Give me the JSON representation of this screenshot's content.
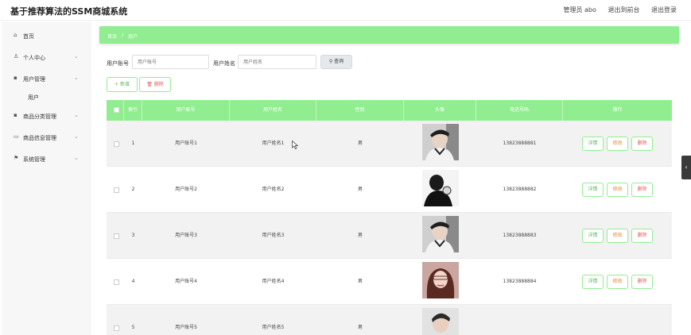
{
  "app": {
    "title": "基于推荐算法的SSM商城系统"
  },
  "topbar": {
    "admin_label": "管理员 abo",
    "back_label": "退出到前台",
    "logout_label": "退出登录"
  },
  "sidebar": {
    "items": [
      {
        "icon": "home-icon",
        "glyph": "⌂",
        "label": "首页",
        "chevron": ""
      },
      {
        "icon": "user-icon",
        "glyph": "♙",
        "label": "个人中心",
        "chevron": "⌄"
      },
      {
        "icon": "grid-icon",
        "glyph": "▪",
        "label": "用户管理",
        "chevron": "⌄"
      },
      {
        "icon": "",
        "glyph": "",
        "label": "用户",
        "chevron": ""
      },
      {
        "icon": "grid-icon",
        "glyph": "▪",
        "label": "商品分类管理",
        "chevron": "⌄"
      },
      {
        "icon": "shop-icon",
        "glyph": "▭",
        "label": "商品信息管理",
        "chevron": "⌄"
      },
      {
        "icon": "flag-icon",
        "glyph": "⚑",
        "label": "系统管理",
        "chevron": "⌄"
      }
    ]
  },
  "breadcrumb": {
    "home": "首页",
    "separator": "/",
    "current": "用户"
  },
  "search": {
    "account_label": "用户账号",
    "account_placeholder": "用户账号",
    "name_label": "用户姓名",
    "name_placeholder": "用户姓名",
    "button_label": "查询",
    "button_icon": "search-icon"
  },
  "actions": {
    "add_label": "新增",
    "delete_label": "删除"
  },
  "table": {
    "headers": {
      "index": "索引",
      "account": "用户账号",
      "name": "用户姓名",
      "gender": "性别",
      "avatar": "头像",
      "phone": "电话号码",
      "ops": "操作"
    },
    "rows": [
      {
        "index": "1",
        "account": "用户账号1",
        "name": "用户姓名1",
        "gender": "男",
        "phone": "13823888881"
      },
      {
        "index": "2",
        "account": "用户账号2",
        "name": "用户姓名2",
        "gender": "男",
        "phone": "13823888882"
      },
      {
        "index": "3",
        "account": "用户账号3",
        "name": "用户姓名3",
        "gender": "男",
        "phone": "13823888883"
      },
      {
        "index": "4",
        "account": "用户账号4",
        "name": "用户姓名4",
        "gender": "男",
        "phone": "13823888884"
      },
      {
        "index": "5",
        "account": "用户账号5",
        "name": "用户姓名5",
        "gender": "男",
        "phone": ""
      }
    ],
    "ops": {
      "detail": "详情",
      "edit": "修改",
      "delete": "删除"
    }
  },
  "colors": {
    "accent": "#90ee90",
    "edit": "#e38a3a",
    "delete": "#e06060"
  }
}
